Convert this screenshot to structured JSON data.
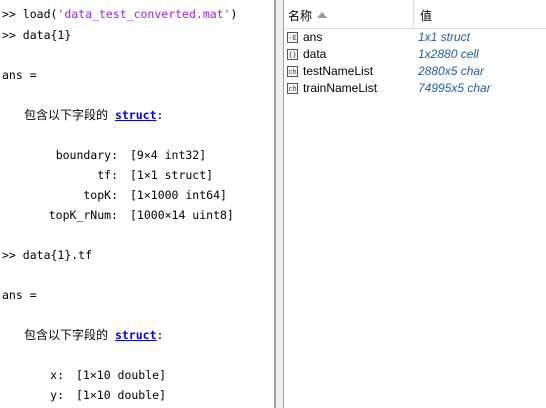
{
  "command_window": {
    "prompt": ">>",
    "cmd1_fn": "load(",
    "cmd1_arg": "'data_test_converted.mat'",
    "cmd1_close": ")",
    "cmd2": "data{1}",
    "ans_label": "ans =",
    "struct_intro": "包含以下字段的",
    "struct_link": "struct",
    "colon": ":",
    "fields1": [
      {
        "name": "boundary:",
        "value": "[9×4 int32]"
      },
      {
        "name": "tf:",
        "value": "[1×1 struct]"
      },
      {
        "name": "topK:",
        "value": "[1×1000 int64]"
      },
      {
        "name": "topK_rNum:",
        "value": "[1000×14 uint8]"
      }
    ],
    "cmd3": "data{1}.tf",
    "fields2": [
      {
        "name": "x:",
        "value": "[1×10 double]"
      },
      {
        "name": "y:",
        "value": "[1×10 double]"
      }
    ]
  },
  "workspace": {
    "header_name": "名称",
    "header_value": "值",
    "rows": [
      {
        "icon": "struct-icon",
        "glyph": "-E",
        "name": "ans",
        "value": "1x1 struct"
      },
      {
        "icon": "cell-icon",
        "glyph": "{}",
        "name": "data",
        "value": "1x2880 cell"
      },
      {
        "icon": "char-icon",
        "glyph": "ch",
        "name": "testNameList",
        "value": "2880x5 char"
      },
      {
        "icon": "char-icon",
        "glyph": "ch",
        "name": "trainNameList",
        "value": "74995x5 char"
      }
    ]
  }
}
